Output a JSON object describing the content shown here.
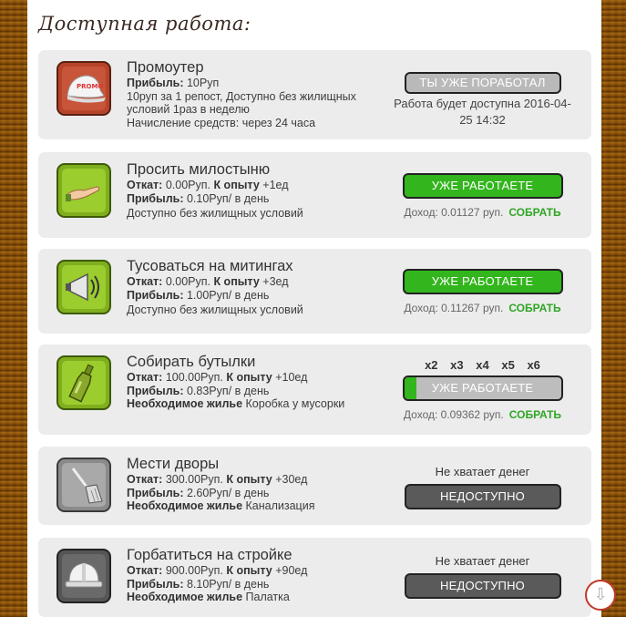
{
  "page": {
    "title": "Доступная работа:"
  },
  "jobs": [
    {
      "title": "Промоутер",
      "lines": [
        {
          "label": "Прибыль:",
          "value": " 10Руп"
        }
      ],
      "desc": "10руп за 1 репост, Доступно без жилищных условий 1раз в неделю",
      "desc2": "Начисление средств: через 24 часа",
      "button": "ТЫ УЖЕ ПОРАБОТАЛ",
      "note": "Работа будет доступна 2016-04-25 14:32"
    },
    {
      "title": "Просить милостыню",
      "lines": [
        {
          "label": "Откат:",
          "value": " 0.00Руп. ",
          "label2": "К опыту",
          "value2": " +1ед"
        },
        {
          "label": "Прибыль:",
          "value": " 0.10Руп/ в день"
        }
      ],
      "desc": "Доступно без жилищных условий",
      "button": "УЖЕ РАБОТАЕТЕ",
      "income_label": "Доход: 0.01127 руп.",
      "collect": "СОБРАТЬ"
    },
    {
      "title": "Тусоваться на митингах",
      "lines": [
        {
          "label": "Откат:",
          "value": " 0.00Руп. ",
          "label2": "К опыту",
          "value2": " +3ед"
        },
        {
          "label": "Прибыль:",
          "value": " 1.00Руп/ в день"
        }
      ],
      "desc": "Доступно без жилищных условий",
      "button": "УЖЕ РАБОТАЕТЕ",
      "income_label": "Доход: 0.11267 руп.",
      "collect": "СОБРАТЬ"
    },
    {
      "title": "Собирать бутылки",
      "lines": [
        {
          "label": "Откат:",
          "value": " 100.00Руп. ",
          "label2": "К опыту",
          "value2": " +10ед"
        },
        {
          "label": "Прибыль:",
          "value": " 0.83Руп/ в день"
        },
        {
          "label": "Необходимое жилье",
          "value": " Коробка у мусорки"
        }
      ],
      "multipliers": [
        "x2",
        "x3",
        "x4",
        "x5",
        "x6"
      ],
      "button": "УЖЕ РАБОТАЕТЕ",
      "progress": 0.08,
      "income_label": "Доход: 0.09362 руп.",
      "collect": "СОБРАТЬ"
    },
    {
      "title": "Мести дворы",
      "lines": [
        {
          "label": "Откат:",
          "value": " 300.00Руп. ",
          "label2": "К опыту",
          "value2": " +30ед"
        },
        {
          "label": "Прибыль:",
          "value": " 2.60Руп/ в день"
        },
        {
          "label": "Необходимое жилье",
          "value": " Канализация"
        }
      ],
      "status": "Не хватает денег",
      "button": "НЕДОСТУПНО"
    },
    {
      "title": "Горбатиться на стройке",
      "lines": [
        {
          "label": "Откат:",
          "value": " 900.00Руп. ",
          "label2": "К опыту",
          "value2": " +90ед"
        },
        {
          "label": "Прибыль:",
          "value": " 8.10Руп/ в день"
        },
        {
          "label": "Необходимое жилье",
          "value": " Палатка"
        }
      ],
      "status": "Не хватает денег",
      "button": "НЕДОСТУПНО"
    }
  ],
  "icons": [
    "promo-cap-icon",
    "begging-hand-icon",
    "megaphone-icon",
    "bottle-icon",
    "broom-icon",
    "hard-hat-icon"
  ],
  "colors": {
    "accent_green": "#33b51d",
    "collect_green": "#2fa624",
    "disabled": "#5a5a5a",
    "done": "#b9b9b9"
  }
}
